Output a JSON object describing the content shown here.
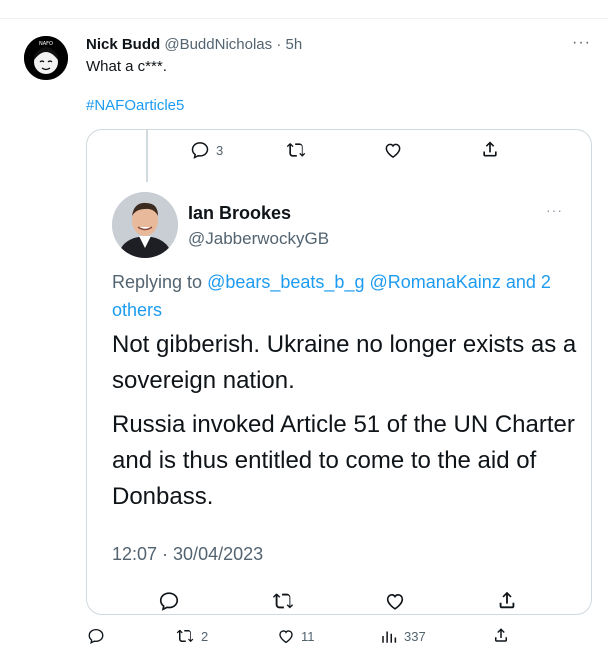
{
  "tweet": {
    "author_name": "Nick Budd",
    "author_handle": "@BuddNicholas",
    "separator": "·",
    "time": "5h",
    "text": "What a c***.",
    "hashtag": "#NAFOarticle5",
    "more": "···",
    "avatar_badge": "NAFO"
  },
  "quoted": {
    "reply_count": "3",
    "author_name": "Ian Brookes",
    "author_handle": "@JabberwockyGB",
    "more": "···",
    "replying_prefix": "Replying to",
    "mentions": [
      "@bears_beats_b_g",
      "@RomanaKainz"
    ],
    "replying_suffix_and": "and 2",
    "replying_suffix_others": "others",
    "paragraph_1": "Not gibberish. Ukraine no longer exists as a sovereign nation.",
    "paragraph_2": "Russia invoked Article 51 of the UN Charter and is thus entitled to come to the aid of Donbass.",
    "timestamp": "12:07 · 30/04/2023"
  },
  "actions": {
    "retweets": "2",
    "likes": "11",
    "views": "337"
  },
  "colors": {
    "link": "#1d9bf0",
    "muted": "#536471",
    "border": "#cfd9de"
  }
}
